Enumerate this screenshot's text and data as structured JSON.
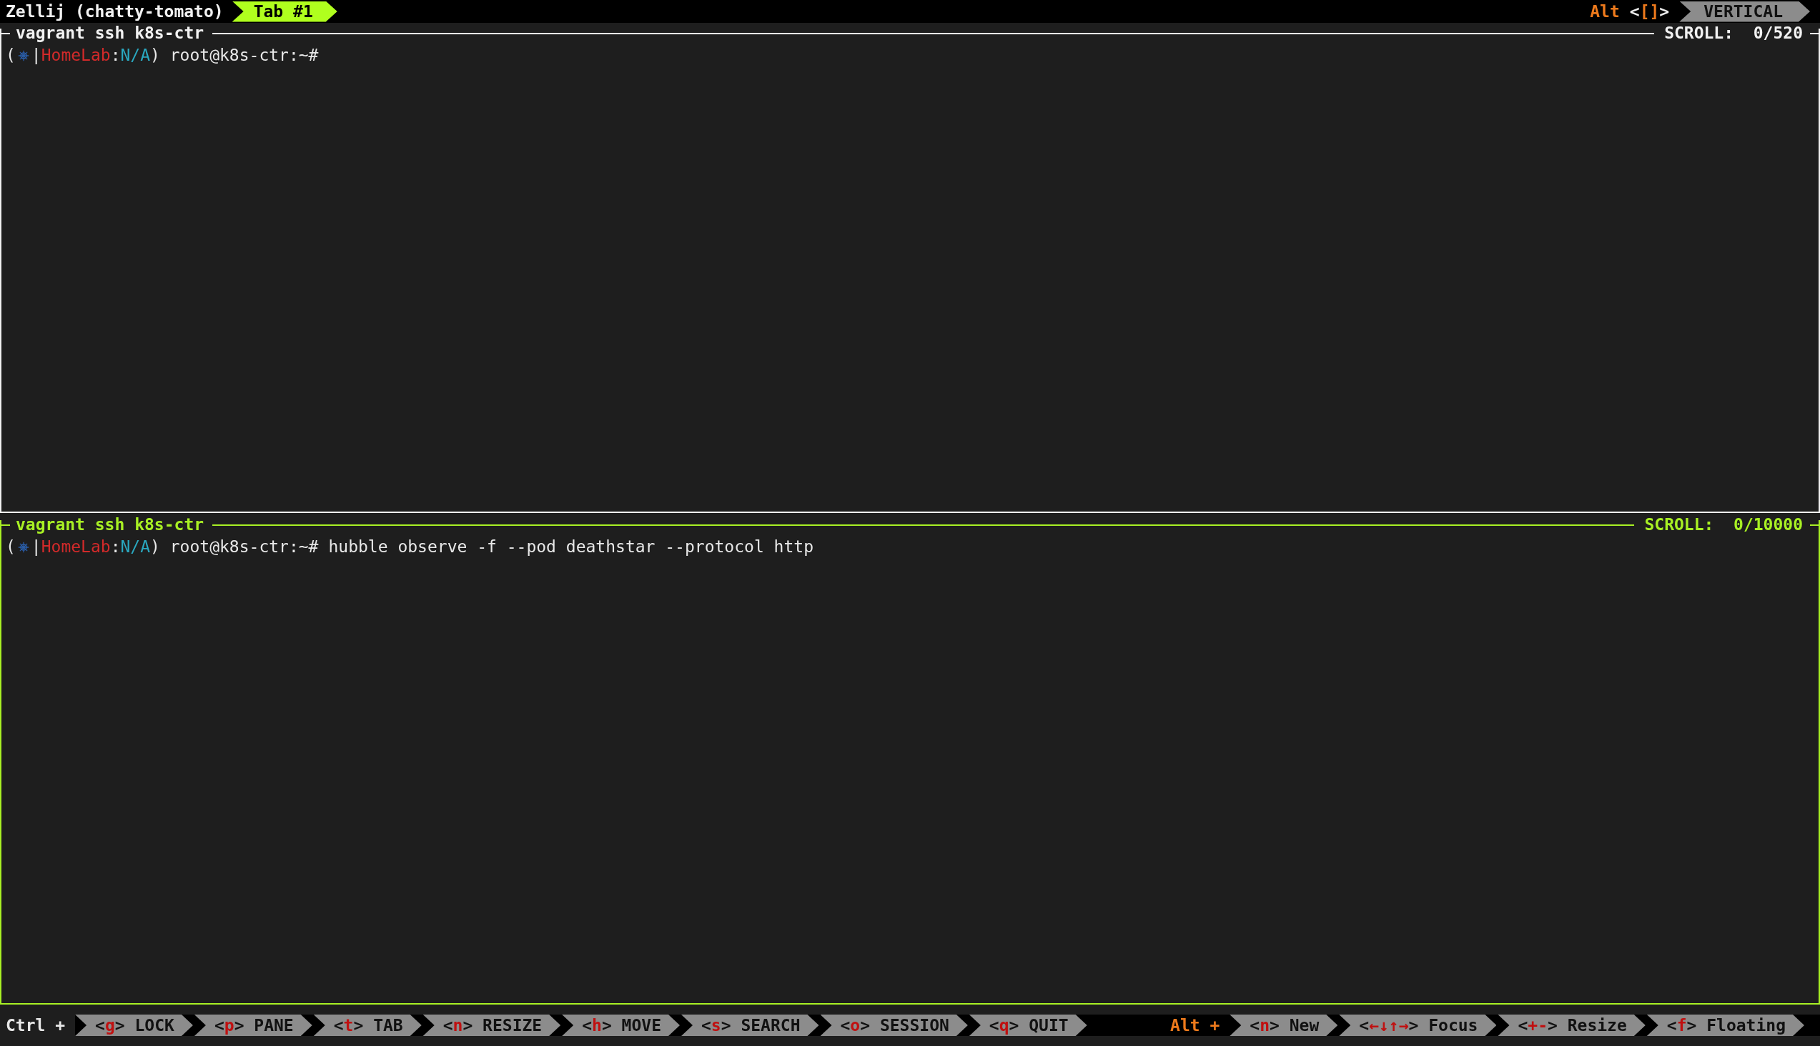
{
  "top_bar": {
    "session": "Zellij (chatty-tomato)",
    "tabs": [
      {
        "label": "Tab #1",
        "selected": true
      }
    ],
    "mode_modifier": "Alt",
    "mode_key": "<[]>",
    "mode": "VERTICAL"
  },
  "panes": [
    {
      "title": "vagrant ssh k8s-ctr",
      "scroll": "SCROLL:  0/520",
      "focused": false,
      "prompt": {
        "open": "(",
        "sep": "|",
        "context": "HomeLab",
        "colon": ":",
        "namespace": "N/A",
        "close": ")",
        "user_host": "root@k8s-ctr:~#"
      }
    },
    {
      "title": "vagrant ssh k8s-ctr",
      "scroll": "SCROLL:  0/10000",
      "focused": true,
      "prompt": {
        "open": "(",
        "sep": "|",
        "context": "HomeLab",
        "colon": ":",
        "namespace": "N/A",
        "close": ")",
        "user_host": "root@k8s-ctr:~#",
        "command": "hubble observe -f --pod deathstar --protocol http"
      }
    }
  ],
  "status_bar": {
    "ctrl_label": "Ctrl +",
    "ctrl_keys": [
      {
        "key": "<g>",
        "label": "LOCK"
      },
      {
        "key": "<p>",
        "label": "PANE"
      },
      {
        "key": "<t>",
        "label": "TAB"
      },
      {
        "key": "<n>",
        "label": "RESIZE"
      },
      {
        "key": "<h>",
        "label": "MOVE"
      },
      {
        "key": "<s>",
        "label": "SEARCH"
      },
      {
        "key": "<o>",
        "label": "SESSION"
      },
      {
        "key": "<q>",
        "label": "QUIT"
      }
    ],
    "alt_label": "Alt +",
    "alt_keys": [
      {
        "key": "<n>",
        "label": "New"
      },
      {
        "key": "<←↓↑→>",
        "label": "Focus"
      },
      {
        "key": "<+->",
        "label": "Resize"
      },
      {
        "key": "<f>",
        "label": "Floating"
      }
    ]
  }
}
